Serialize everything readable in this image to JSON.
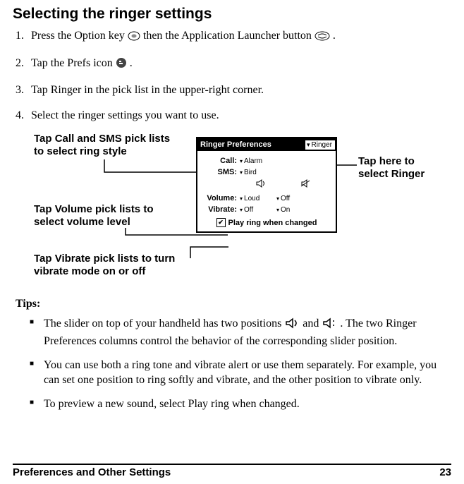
{
  "title": "Selecting the ringer settings",
  "steps": {
    "s1a": "Press the Option key ",
    "s1b": " then the Application Launcher button ",
    "s1c": ".",
    "s2a": "Tap the Prefs icon ",
    "s2b": ".",
    "s3": "Tap Ringer in the pick list in the upper-right corner.",
    "s4": "Select the ringer settings you want to use."
  },
  "callouts": {
    "callsms": "Tap Call and SMS pick lists to select ring style",
    "volume": "Tap Volume pick lists to select volume level",
    "vibrate": "Tap Vibrate pick lists to turn vibrate mode on or off",
    "ringer": "Tap here to select Ringer"
  },
  "screenshot": {
    "title": "Ringer Preferences",
    "menu": "Ringer",
    "rows": {
      "call_label": "Call:",
      "call_val": "Alarm",
      "sms_label": "SMS:",
      "sms_val": "Bird",
      "vol_label": "Volume:",
      "vol_val1": "Loud",
      "vol_val2": "Off",
      "vib_label": "Vibrate:",
      "vib_val1": "Off",
      "vib_val2": "On"
    },
    "play": "Play ring when changed"
  },
  "tips_label": "Tips:",
  "tips": {
    "t1a": "The slider on top of your handheld has two positions  ",
    "t1b": " and ",
    "t1c": " . The two Ringer Preferences columns control the behavior of the corresponding slider position.",
    "t2": "You can use both a ring tone and vibrate alert or use them separately. For example, you can set one position to ring softly and vibrate, and the other position to vibrate only.",
    "t3": "To preview a new sound, select Play ring when changed."
  },
  "footer": {
    "left": "Preferences and Other Settings",
    "right": "23"
  }
}
